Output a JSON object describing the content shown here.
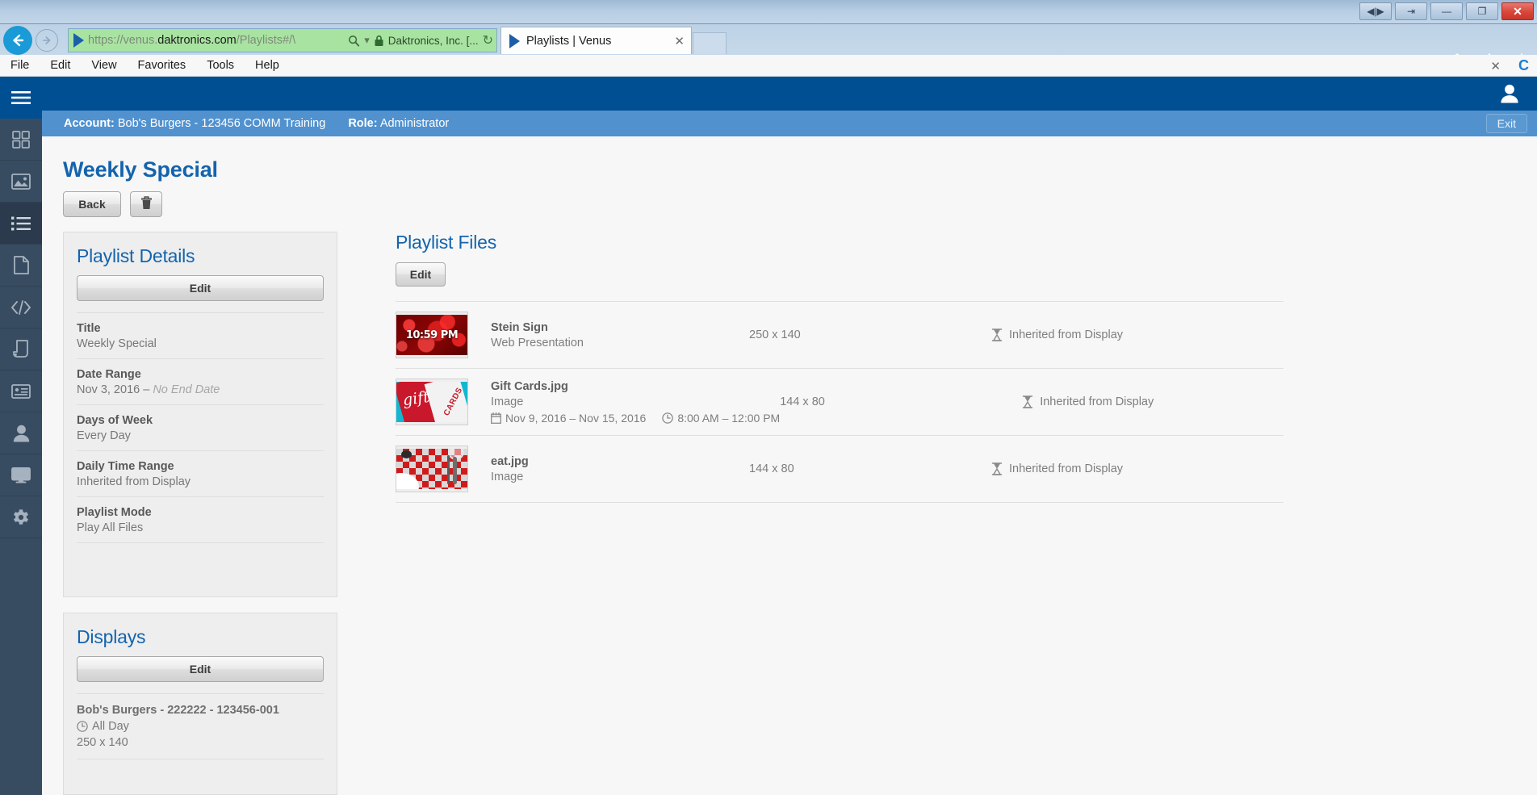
{
  "window": {
    "controls": [
      {
        "name": "restore-split",
        "glyph": "◀|▶"
      },
      {
        "name": "detach",
        "glyph": "⇥"
      },
      {
        "name": "minimize",
        "glyph": "—"
      },
      {
        "name": "maximize",
        "glyph": "❐"
      },
      {
        "name": "close",
        "glyph": "✕"
      }
    ]
  },
  "browser": {
    "back_glyph": "⟵",
    "forward_glyph": "⟶",
    "url_full": "https://venus.daktronics.com/Playlists#/\\",
    "url_scheme": "https://venus.",
    "url_host": "daktronics.com",
    "url_path": "/Playlists#/\\",
    "search_glyph": "🔍",
    "dropdown_glyph": "▾",
    "lock_glyph": "🔒",
    "identity": "Daktronics, Inc. [...",
    "refresh_glyph": "↻",
    "tab_title": "Playlists | Venus",
    "tab_close_glyph": "✕",
    "chrome_icons": [
      "home-icon",
      "favorites-star-icon",
      "settings-gear-icon"
    ]
  },
  "menu_bar": {
    "items": [
      "File",
      "Edit",
      "View",
      "Favorites",
      "Tools",
      "Help"
    ],
    "right": {
      "close_glyph": "✕",
      "compat_glyph": "C"
    }
  },
  "sidebar": {
    "items": [
      {
        "name": "menu-toggle",
        "icon": "hamburger-icon",
        "state": "header"
      },
      {
        "name": "dashboard",
        "icon": "grid-icon",
        "state": "normal"
      },
      {
        "name": "media",
        "icon": "image-icon",
        "state": "normal"
      },
      {
        "name": "playlists",
        "icon": "list-icon",
        "state": "active"
      },
      {
        "name": "documents",
        "icon": "document-icon",
        "state": "normal"
      },
      {
        "name": "html-content",
        "icon": "code-icon",
        "state": "normal"
      },
      {
        "name": "scripts",
        "icon": "scroll-icon",
        "state": "normal"
      },
      {
        "name": "cards",
        "icon": "id-card-icon",
        "state": "normal"
      },
      {
        "name": "users",
        "icon": "person-icon",
        "state": "normal"
      },
      {
        "name": "displays",
        "icon": "monitor-icon",
        "state": "normal"
      },
      {
        "name": "settings",
        "icon": "gear-icon",
        "state": "normal"
      }
    ]
  },
  "app_header": {
    "user_icon": "user-avatar-icon",
    "account_label": "Account:",
    "account_value": "Bob's Burgers - 123456 COMM Training",
    "role_label": "Role:",
    "role_value": "Administrator",
    "exit_label": "Exit"
  },
  "page": {
    "title": "Weekly Special",
    "back_label": "Back",
    "delete_icon": "trash-icon"
  },
  "playlist_details": {
    "heading": "Playlist Details",
    "edit_label": "Edit",
    "rows": [
      {
        "label": "Title",
        "value": "Weekly Special",
        "muted": ""
      },
      {
        "label": "Date Range",
        "value": "Nov 3, 2016 – ",
        "muted": "No End Date"
      },
      {
        "label": "Days of Week",
        "value": "Every Day",
        "muted": ""
      },
      {
        "label": "Daily Time Range",
        "value": "Inherited from Display",
        "muted": ""
      },
      {
        "label": "Playlist Mode",
        "value": "Play All Files",
        "muted": ""
      }
    ]
  },
  "displays": {
    "heading": "Displays",
    "edit_label": "Edit",
    "items": [
      {
        "name": "Bob's Burgers - 222222 - 123456-001",
        "schedule_icon": "clock-icon",
        "schedule": "All Day",
        "size": "250 x 140"
      }
    ]
  },
  "playlist_files": {
    "heading": "Playlist Files",
    "edit_label": "Edit",
    "rows": [
      {
        "thumb": "stein-sign-thumbnail",
        "thumb_text": "10:59 PM",
        "name": "Stein Sign",
        "type": "Web Presentation",
        "date_icon": "",
        "date_range": "",
        "time_icon": "",
        "time_range": "",
        "size": "250 x 140",
        "schedule_icon": "hourglass-icon",
        "schedule": "Inherited from Display"
      },
      {
        "thumb": "gift-cards-thumbnail",
        "thumb_text": "",
        "name": "Gift Cards.jpg",
        "type": "Image",
        "date_icon": "calendar-icon",
        "date_range": "Nov 9, 2016 – Nov 15, 2016",
        "time_icon": "clock-icon",
        "time_range": "8:00 AM – 12:00 PM",
        "size": "144 x 80",
        "schedule_icon": "hourglass-icon",
        "schedule": "Inherited from Display"
      },
      {
        "thumb": "eat-thumbnail",
        "thumb_text": "",
        "name": "eat.jpg",
        "type": "Image",
        "date_icon": "",
        "date_range": "",
        "time_icon": "",
        "time_range": "",
        "size": "144 x 80",
        "schedule_icon": "hourglass-icon",
        "schedule": "Inherited from Display"
      }
    ]
  },
  "colors": {
    "header_blue": "#004f93",
    "subheader_blue": "#5191ce",
    "sidebar": "#384c61",
    "link_blue": "#1464ad",
    "address_bar_green": "#a9e3a1"
  }
}
